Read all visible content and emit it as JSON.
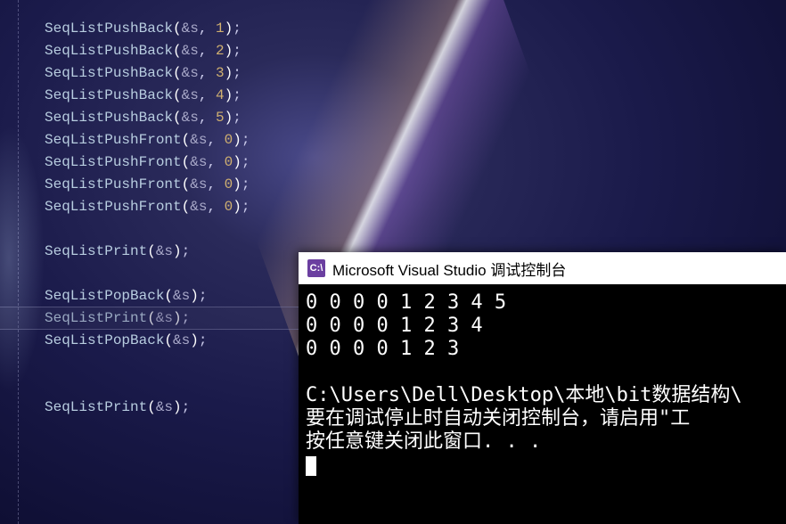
{
  "code": {
    "lines": [
      {
        "fn": "SeqListPushBack",
        "args": [
          "&s",
          "1"
        ]
      },
      {
        "fn": "SeqListPushBack",
        "args": [
          "&s",
          "2"
        ]
      },
      {
        "fn": "SeqListPushBack",
        "args": [
          "&s",
          "3"
        ]
      },
      {
        "fn": "SeqListPushBack",
        "args": [
          "&s",
          "4"
        ]
      },
      {
        "fn": "SeqListPushBack",
        "args": [
          "&s",
          "5"
        ]
      },
      {
        "fn": "SeqListPushFront",
        "args": [
          "&s",
          "0"
        ]
      },
      {
        "fn": "SeqListPushFront",
        "args": [
          "&s",
          "0"
        ]
      },
      {
        "fn": "SeqListPushFront",
        "args": [
          "&s",
          "0"
        ]
      },
      {
        "fn": "SeqListPushFront",
        "args": [
          "&s",
          "0"
        ]
      },
      {
        "blank": true
      },
      {
        "fn": "SeqListPrint",
        "args": [
          "&s"
        ]
      },
      {
        "blank": true
      },
      {
        "fn": "SeqListPopBack",
        "args": [
          "&s"
        ]
      },
      {
        "fn": "SeqListPrint",
        "args": [
          "&s"
        ]
      },
      {
        "fn": "SeqListPopBack",
        "args": [
          "&s"
        ]
      },
      {
        "blank": true
      },
      {
        "blank": true
      },
      {
        "fn": "SeqListPrint",
        "args": [
          "&s"
        ]
      }
    ],
    "highlight_index": 13
  },
  "console": {
    "icon_text": "C:\\",
    "title": "Microsoft Visual Studio 调试控制台",
    "output_rows": [
      "0 0 0 0 1 2 3 4 5",
      "0 0 0 0 1 2 3 4",
      "0 0 0 0 1 2 3",
      "",
      "C:\\Users\\Dell\\Desktop\\本地\\bit数据结构\\",
      "要在调试停止时自动关闭控制台，请启用\"工",
      "按任意键关闭此窗口. . ."
    ]
  }
}
